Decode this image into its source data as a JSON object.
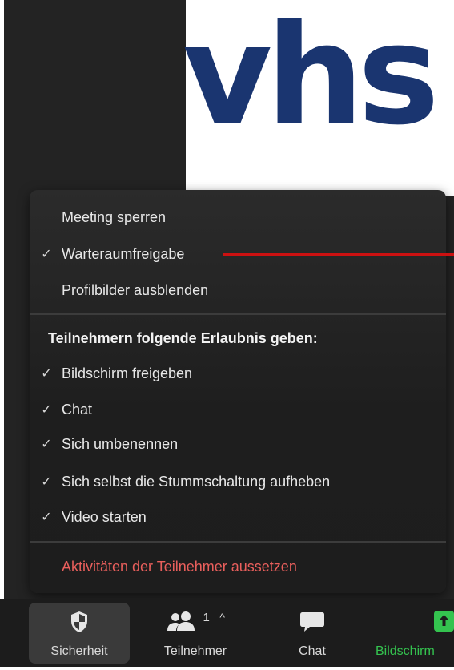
{
  "background": {
    "logo_text": "vhs",
    "logo_color": "#1a3570"
  },
  "menu": {
    "items": [
      {
        "label": "Meeting sperren",
        "checked": false
      },
      {
        "label": "Warteraumfreigabe",
        "checked": true
      },
      {
        "label": "Profilbilder ausblenden",
        "checked": false
      }
    ],
    "permissions_heading": "Teilnehmern folgende Erlaubnis geben:",
    "permissions": [
      {
        "label": "Bildschirm freigeben",
        "checked": true
      },
      {
        "label": "Chat",
        "checked": true
      },
      {
        "label": "Sich umbenennen",
        "checked": true
      },
      {
        "label": "Sich selbst die Stummschaltung aufheben",
        "checked": true
      },
      {
        "label": "Video starten",
        "checked": true
      }
    ],
    "suspend_label": "Aktivitäten der Teilnehmer aussetzen",
    "check_glyph": "✓",
    "danger_color": "#e95f5c"
  },
  "annotation": {
    "line_color": "#cc1111"
  },
  "toolbar": {
    "security_label": "Sicherheit",
    "participants_label": "Teilnehmer",
    "participants_count": "1",
    "participants_caret": "^",
    "chat_label": "Chat",
    "share_label": "Bildschirm",
    "share_color": "#34c34f",
    "share_icon_arrow": "↑",
    "icons": [
      "shield-icon",
      "participants-icon",
      "chat-bubble-icon",
      "share-screen-icon"
    ]
  }
}
